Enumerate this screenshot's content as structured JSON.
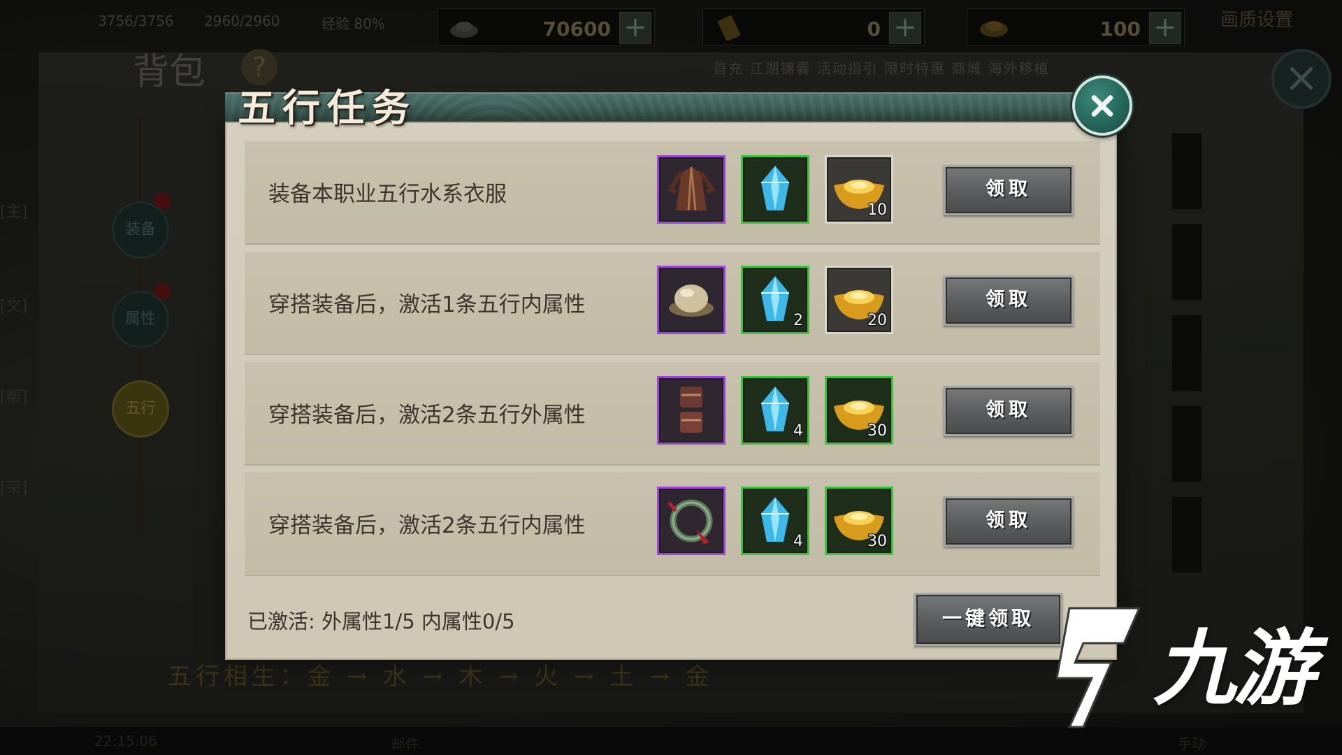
{
  "background": {
    "topbar": {
      "hp": "3756/3756",
      "mp": "2960/2960",
      "exp": "经验 80%",
      "resources": [
        {
          "icon": "silver-ingot-icon",
          "value": "70600"
        },
        {
          "icon": "gold-ticket-icon",
          "value": "0"
        },
        {
          "icon": "gold-ingot-icon",
          "value": "100"
        }
      ],
      "plus_glyph": "+",
      "right_text": "画质设置"
    },
    "bag_title": "背包",
    "help_glyph": "?",
    "sub_tabs": "首充  江湖锦囊  活动指引  限时特惠  商城  海外移植",
    "side_tabs": [
      "装备",
      "属性",
      "五行"
    ],
    "left_chat": [
      "[主]",
      "[文]",
      "[帮]",
      "[荣]"
    ],
    "wuxing_cycle": "五行相生：金 → 水 → 木 → 火 → 土 → 金",
    "bottom": {
      "time": "22:15:06",
      "center": "邮件",
      "right": "手动"
    }
  },
  "dialog": {
    "title": "五行任务",
    "tasks": [
      {
        "text": "装备本职业五行水系衣服",
        "rewards": [
          {
            "icon": "robe-icon",
            "rarity": "purple",
            "count": ""
          },
          {
            "icon": "blue-crystal-icon",
            "rarity": "green",
            "count": ""
          },
          {
            "icon": "gold-ingot-icon",
            "rarity": "white",
            "count": "10"
          }
        ],
        "button": "领取"
      },
      {
        "text": "穿搭装备后，激活1条五行内属性",
        "rewards": [
          {
            "icon": "hat-icon",
            "rarity": "purple",
            "count": ""
          },
          {
            "icon": "blue-crystal-icon",
            "rarity": "green",
            "count": "2"
          },
          {
            "icon": "gold-ingot-icon",
            "rarity": "white",
            "count": "20"
          }
        ],
        "button": "领取"
      },
      {
        "text": "穿搭装备后，激活2条五行外属性",
        "rewards": [
          {
            "icon": "bracer-icon",
            "rarity": "purple",
            "count": ""
          },
          {
            "icon": "blue-crystal-icon",
            "rarity": "green",
            "count": "4"
          },
          {
            "icon": "gold-ingot-icon",
            "rarity": "green",
            "count": "30"
          }
        ],
        "button": "领取"
      },
      {
        "text": "穿搭装备后，激活2条五行内属性",
        "rewards": [
          {
            "icon": "jade-bracelet-icon",
            "rarity": "purple",
            "count": ""
          },
          {
            "icon": "blue-crystal-icon",
            "rarity": "green",
            "count": "4"
          },
          {
            "icon": "gold-ingot-icon",
            "rarity": "green",
            "count": "30"
          }
        ],
        "button": "领取"
      }
    ],
    "status": "已激活: 外属性1/5  内属性0/5",
    "claim_all": "一键领取"
  },
  "watermark": {
    "text": "九游",
    "mark": "9"
  },
  "colors": {
    "rarity_purple": "#9b46d6",
    "rarity_green": "#3cc23a",
    "rarity_white": "#d9d6cc",
    "header_teal": "#37564f",
    "panel_beige": "#d5cfbe"
  }
}
